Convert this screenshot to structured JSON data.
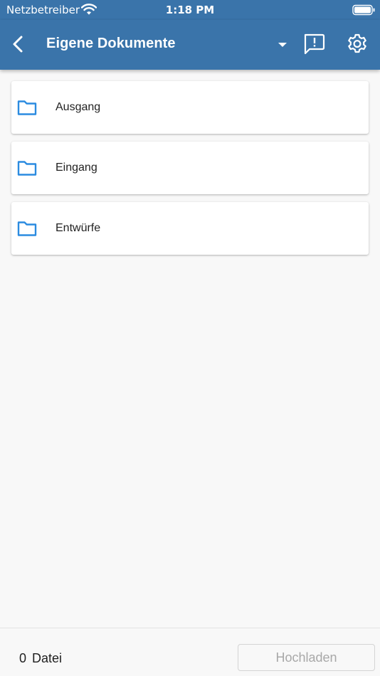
{
  "status_bar": {
    "carrier": "Netzbetreiber",
    "time": "1:18 PM",
    "wifi_icon": "wifi-icon",
    "battery_icon": "battery-icon"
  },
  "app_bar": {
    "title": "Eigene Dokumente",
    "back_icon": "chevron-left-icon",
    "dropdown_icon": "caret-down-icon",
    "feedback_icon": "feedback-icon",
    "settings_icon": "gear-icon",
    "background_color": "#3a74aa"
  },
  "folders": [
    {
      "label": "Ausgang",
      "icon": "folder-icon"
    },
    {
      "label": "Eingang",
      "icon": "folder-icon"
    },
    {
      "label": "Entwürfe",
      "icon": "folder-icon"
    }
  ],
  "folder_icon_color": "#2b8be0",
  "footer": {
    "file_count": "0",
    "file_count_label": "Datei",
    "upload_label": "Hochladen",
    "upload_enabled": false
  }
}
